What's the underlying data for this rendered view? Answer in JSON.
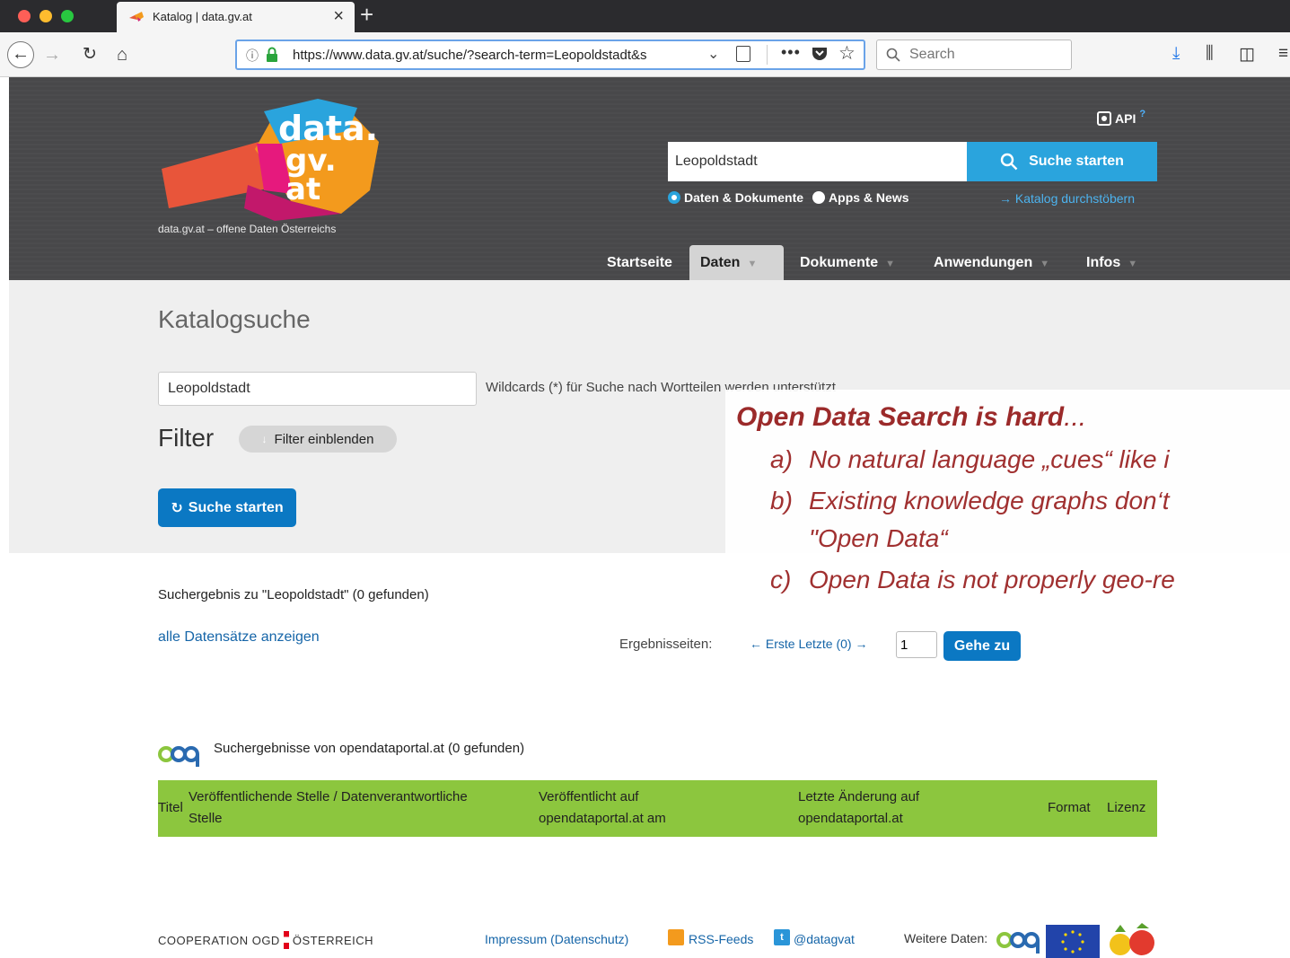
{
  "browser": {
    "tab_title": "Katalog | data.gv.at",
    "url": "https://www.data.gv.at/suche/?search-term=Leopoldstadt&s",
    "search_placeholder": "Search",
    "new_tab": "+",
    "tab_close": "×"
  },
  "header": {
    "logo_text": [
      "data.",
      "gv.",
      "at"
    ],
    "tagline": "data.gv.at – offene Daten Österreichs",
    "api_label": "API",
    "search_value": "Leopoldstadt",
    "search_button": "Suche starten",
    "radio_data": "Daten & Dokumente",
    "radio_apps": "Apps & News",
    "katalog_link": "→ Katalog durchstöbern",
    "nav": [
      {
        "label": "Startseite"
      },
      {
        "label": "Daten"
      },
      {
        "label": "Dokumente"
      },
      {
        "label": "Anwendungen"
      },
      {
        "label": "Infos"
      }
    ]
  },
  "main": {
    "title": "Katalogsuche",
    "search_value": "Leopoldstadt",
    "wildcard_hint": "Wildcards (*) für Suche nach Wortteilen werden unterstützt",
    "filter_label": "Filter",
    "filter_button": "Filter einblenden",
    "search_button": "Suche starten",
    "result_heading": "Suchergebnis zu \"Leopoldstadt\" (0 gefunden)",
    "show_all_link": "alle Datensätze anzeigen",
    "pager_label": "Ergebnisseiten:",
    "pager_links": "← Erste Letzte (0) →",
    "pager_value": "1",
    "goto_button": "Gehe zu",
    "odp_heading": "Suchergebnisse von opendataportal.at (0 gefunden)",
    "table_headers": {
      "titel": "Titel",
      "stelle_line1": "Veröffentlichende Stelle / Datenverantwortliche",
      "stelle_line2": "Stelle",
      "veroeff_line1": "Veröffentlicht auf",
      "veroeff_line2": "opendataportal.at am",
      "aenderung_line1": "Letzte Änderung auf",
      "aenderung_line2": "opendataportal.at",
      "format": "Format",
      "lizenz": "Lizenz"
    }
  },
  "footer": {
    "cooperation_left": "COOPERATION OGD",
    "cooperation_right": "ÖSTERREICH",
    "impressum": "Impressum (Datenschutz)",
    "rss": "RSS-Feeds",
    "twitter": "@datagvat",
    "weitere": "Weitere Daten:"
  },
  "overlay": {
    "title": "Open Data Search is hard",
    "title_suffix": "...",
    "lines": [
      {
        "marker": "a)",
        "text": "No natural language „cues“ like i"
      },
      {
        "marker": "b)",
        "text": "Existing knowledge graphs don‘t"
      },
      {
        "marker": "",
        "text": "\"Open Data“"
      },
      {
        "marker": "c)",
        "text": "Open Data is not properly geo-re"
      }
    ]
  },
  "colors": {
    "accent_blue": "#0b78c3",
    "header_gray": "#48484a",
    "table_green": "#8cc63e",
    "overlay_red": "#a03030"
  }
}
